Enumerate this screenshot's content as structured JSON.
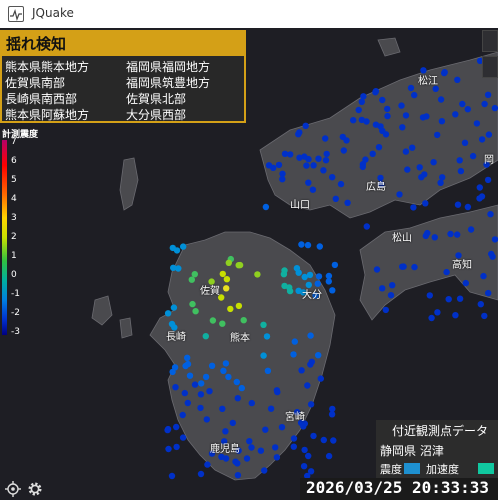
{
  "window": {
    "title": "JQuake"
  },
  "alert": {
    "header": "揺れ検知",
    "regions": [
      "熊本県熊本地方",
      "福岡県福岡地方",
      "佐賀県南部",
      "福岡県筑豊地方",
      "長崎県南西部",
      "佐賀県北部",
      "熊本県阿蘇地方",
      "大分県西部"
    ]
  },
  "scale": {
    "title": "計測震度",
    "ticks": [
      "7",
      "6",
      "5",
      "4",
      "3",
      "2",
      "1",
      "0",
      "-1",
      "-2",
      "-3"
    ]
  },
  "map_labels": [
    "松江",
    "岡",
    "広島",
    "山口",
    "松山",
    "高知",
    "佐賀",
    "大分",
    "長崎",
    "熊本",
    "宮崎",
    "鹿児島"
  ],
  "nearby": {
    "title": "付近観測点データ",
    "station": "静岡県 沼津",
    "legend_intensity": "震度",
    "legend_acceleration": "加速度",
    "intensity_color": "#1e90d0",
    "acceleration_color": "#10c8a0"
  },
  "clock": "2026/03/25 20:33:33",
  "icons": [
    "app-icon",
    "locate-icon",
    "gear-icon"
  ],
  "colors": {
    "alert_accent": "#d4a017",
    "map_background": "#1e1e24",
    "land": "#4a4a4e"
  }
}
